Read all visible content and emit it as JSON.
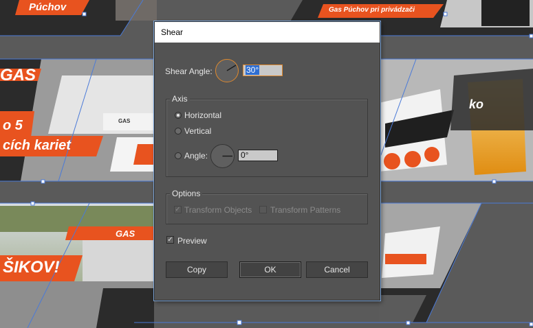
{
  "artwork": {
    "texts": {
      "puchov": "Púchov",
      "gas_puchov": "Gas Púchov pri privádzači",
      "gas": "GAS",
      "o5": "o 5",
      "kariet": "cích kariet",
      "sikov": "ŠIKOV!",
      "gas_sign": "GAS",
      "car_plate": "GAS",
      "ko": "ko"
    },
    "colors": {
      "orange": "#e8531f",
      "selection": "#4a7ad8",
      "banner_dark": "#2b2b2b"
    }
  },
  "dialog": {
    "title": "Shear",
    "shear_angle_label": "Shear Angle:",
    "shear_angle_value": "30°",
    "axis": {
      "title": "Axis",
      "horizontal": "Horizontal",
      "vertical": "Vertical",
      "angle_label": "Angle:",
      "angle_value": "0°",
      "selected": "horizontal"
    },
    "options": {
      "title": "Options",
      "transform_objects": "Transform Objects",
      "transform_patterns": "Transform Patterns",
      "transform_objects_checked": true,
      "transform_patterns_checked": false
    },
    "preview_label": "Preview",
    "preview_checked": true,
    "buttons": {
      "copy": "Copy",
      "ok": "OK",
      "cancel": "Cancel"
    }
  }
}
